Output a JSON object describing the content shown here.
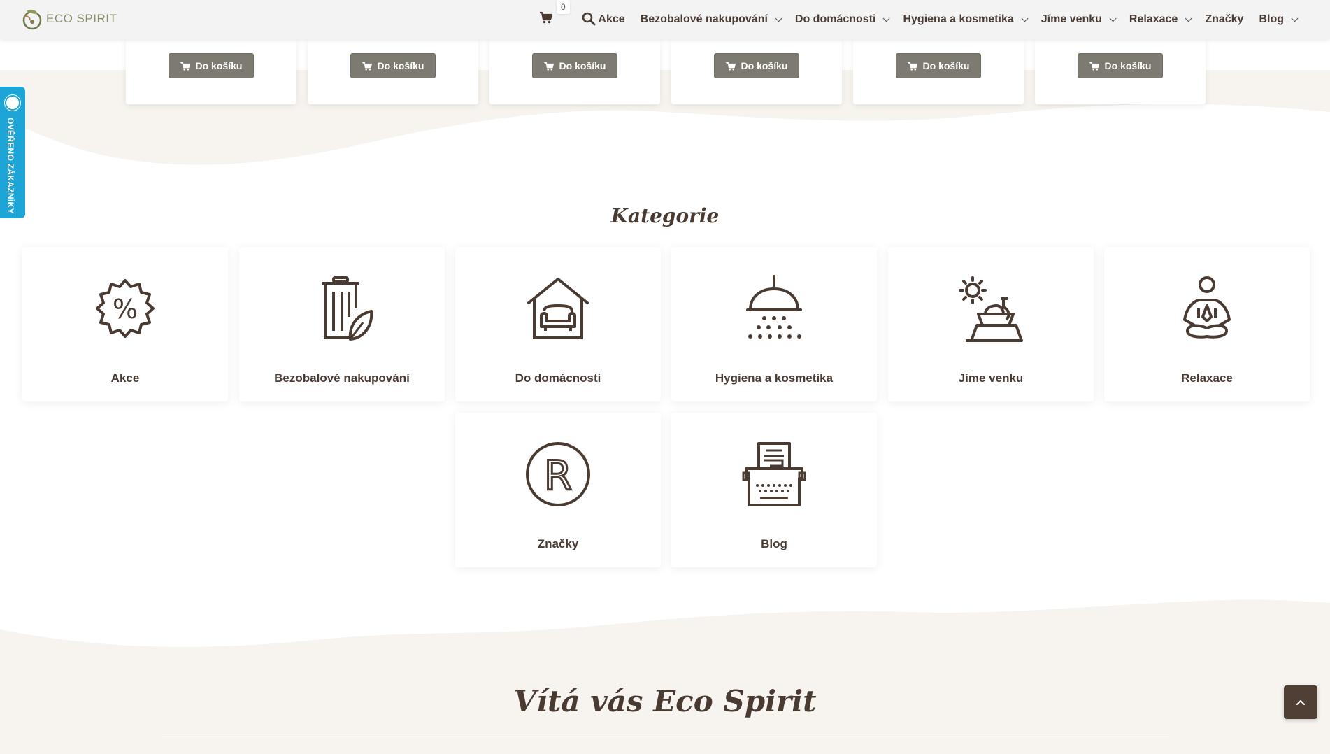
{
  "header": {
    "logo_text": "ECO SPIRIT",
    "cart_count": "0",
    "nav": [
      {
        "label": "Akce",
        "has_dropdown": false
      },
      {
        "label": "Bezobalové nakupování",
        "has_dropdown": true
      },
      {
        "label": "Do domácnosti",
        "has_dropdown": true
      },
      {
        "label": "Hygiena a kosmetika",
        "has_dropdown": true
      },
      {
        "label": "Jíme venku",
        "has_dropdown": true
      },
      {
        "label": "Relaxace",
        "has_dropdown": true
      },
      {
        "label": "Značky",
        "has_dropdown": false
      },
      {
        "label": "Blog",
        "has_dropdown": true
      }
    ]
  },
  "products": {
    "button_label": "Do košíku",
    "count": 6
  },
  "verified_badge": {
    "label": "OVĚŘENO ZÁKAZNÍKY"
  },
  "categories": {
    "title": "Kategorie",
    "items": [
      {
        "label": "Akce",
        "icon": "percent-badge-icon"
      },
      {
        "label": "Bezobalové nakupování",
        "icon": "bin-leaf-icon"
      },
      {
        "label": "Do domácnosti",
        "icon": "house-sofa-icon"
      },
      {
        "label": "Hygiena a kosmetika",
        "icon": "shower-icon"
      },
      {
        "label": "Jíme venku",
        "icon": "picnic-icon"
      },
      {
        "label": "Relaxace",
        "icon": "meditation-icon"
      },
      {
        "label": "Značky",
        "icon": "registered-icon"
      },
      {
        "label": "Blog",
        "icon": "typewriter-icon"
      }
    ]
  },
  "welcome": {
    "title": "Vítá vás Eco Spirit"
  },
  "colors": {
    "accent_brown": "#4a3b32",
    "cream": "#f7f3ee",
    "button_grey": "#7d7a72",
    "verified_blue": "#1ea5d8"
  }
}
